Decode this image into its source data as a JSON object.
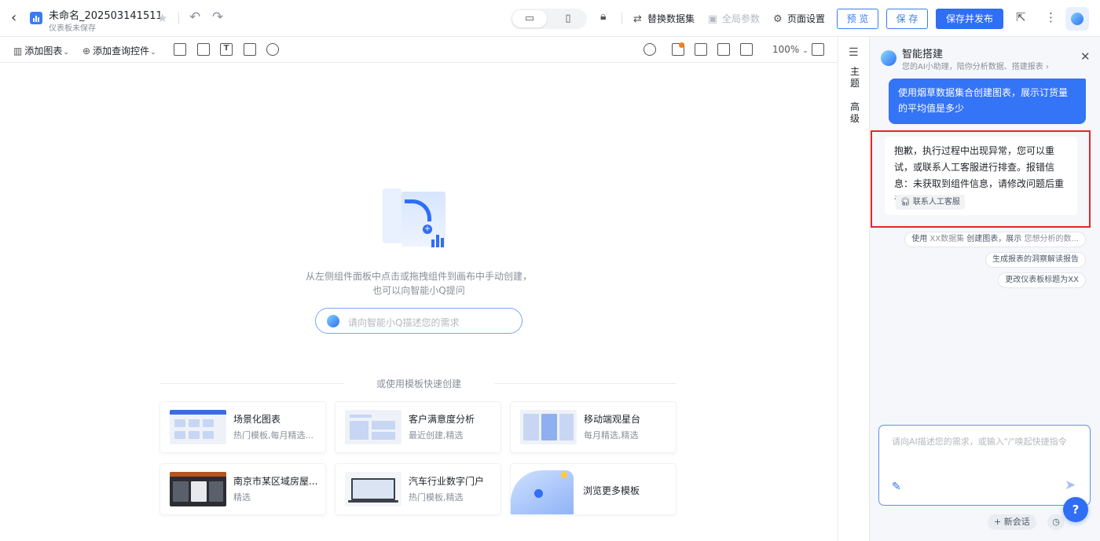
{
  "header": {
    "title": "未命名_202503141511",
    "subtitle": "仪表板未保存",
    "replace_dataset": "替换数据集",
    "global_params": "全局参数",
    "page_settings": "页面设置",
    "preview": "预 览",
    "save": "保 存",
    "save_publish": "保存并发布"
  },
  "toolbar": {
    "add_chart": "添加图表",
    "add_query_control": "添加查询控件",
    "zoom": "100%"
  },
  "canvas": {
    "hint_line1": "从左侧组件面板中点击或拖拽组件到画布中手动创建，",
    "hint_line2": "也可以向智能小Q提问",
    "ask_placeholder": "请向智能小Q描述您的需求",
    "template_divider": "或使用模板快速创建",
    "templates": [
      {
        "name": "场景化图表",
        "tags": "热门模板,每月精选..."
      },
      {
        "name": "客户满意度分析",
        "tags": "最近创建,精选"
      },
      {
        "name": "移动端观星台",
        "tags": "每月精选,精选"
      },
      {
        "name": "南京市某区域房屋...",
        "tags": "精选"
      },
      {
        "name": "汽车行业数字门户",
        "tags": "热门模板,精选"
      },
      {
        "name": "浏览更多模板",
        "tags": ""
      }
    ]
  },
  "rail": {
    "theme_tab": [
      "主",
      "题"
    ],
    "advanced_tab": [
      "高",
      "级"
    ]
  },
  "ai_panel": {
    "title": "智能搭建",
    "subtitle": "您的AI小助理，陪你分析数据、搭建报表",
    "user_message": "使用烟草数据集合创建图表，展示订货量的平均值是多少",
    "bot_message": "抱歉，执行过程中出现异常，您可以重试，或联系人工客服进行排查。报错信息：未获取到组件信息，请修改问题后重试",
    "contact_support": "联系人工客服",
    "suggestions": [
      {
        "lead": "使用 ",
        "muted": "XX数据集",
        "mid": " 创建图表，展示 ",
        "tail": "您想分析的数..."
      },
      {
        "lead": "生成报表的洞察解读报告",
        "muted": "",
        "mid": "",
        "tail": ""
      },
      {
        "lead": "更改仪表板标题为XX",
        "muted": "",
        "mid": "",
        "tail": ""
      }
    ],
    "composer_placeholder": "请向AI描述您的需求，或输入\"/\"唤起快捷指令",
    "new_chat": "+ 新会话"
  }
}
